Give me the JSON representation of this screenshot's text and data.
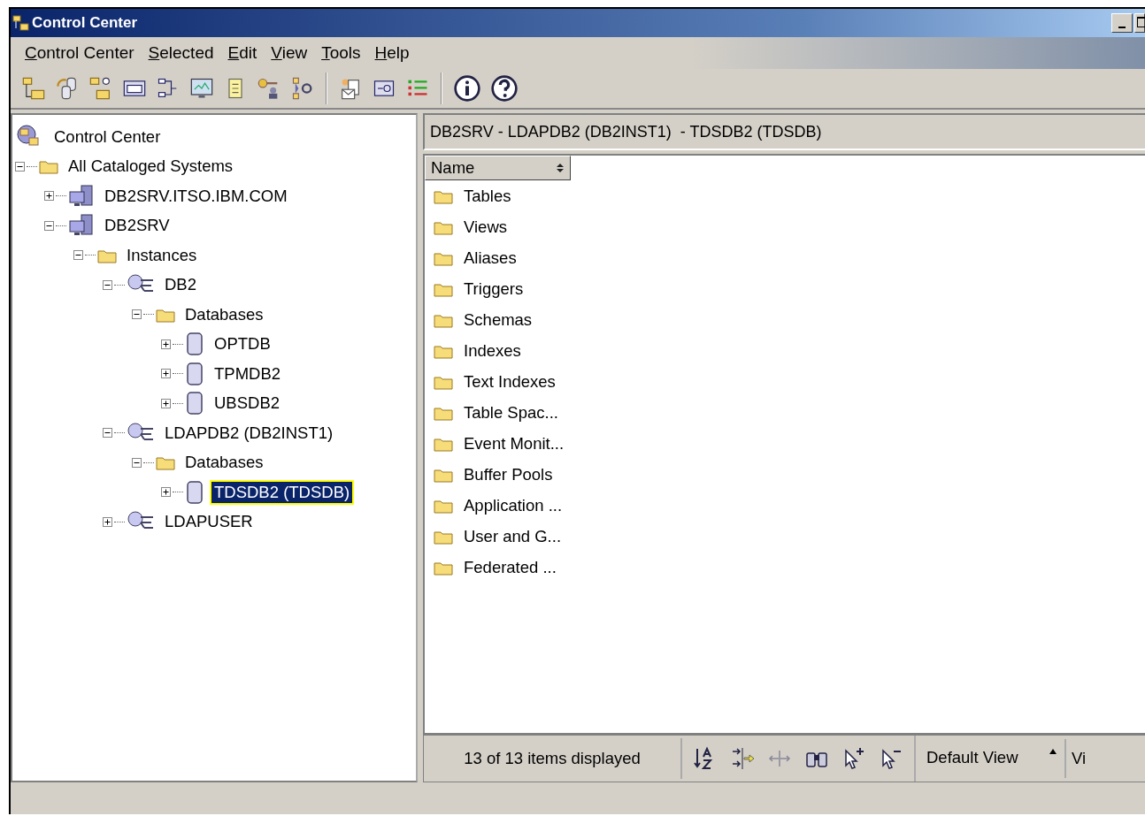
{
  "window": {
    "title": "Control Center"
  },
  "menu": [
    "Control Center",
    "Selected",
    "Edit",
    "View",
    "Tools",
    "Help"
  ],
  "tree": [
    {
      "label": "Control Center",
      "kind": "root",
      "selected": false,
      "children": [
        {
          "label": "All Cataloged Systems",
          "kind": "folder",
          "expanded": true,
          "selected": false,
          "children": [
            {
              "label": "DB2SRV.ITSO.IBM.COM",
              "kind": "system",
              "expanded": false,
              "selected": false
            },
            {
              "label": "DB2SRV",
              "kind": "system",
              "expanded": true,
              "selected": false,
              "children": [
                {
                  "label": "Instances",
                  "kind": "folder",
                  "expanded": true,
                  "selected": false,
                  "children": [
                    {
                      "label": "DB2",
                      "kind": "instance",
                      "expanded": true,
                      "selected": false,
                      "children": [
                        {
                          "label": "Databases",
                          "kind": "folder",
                          "expanded": true,
                          "selected": false,
                          "children": [
                            {
                              "label": "OPTDB",
                              "kind": "database",
                              "expanded": false,
                              "selected": false
                            },
                            {
                              "label": "TPMDB2",
                              "kind": "database",
                              "expanded": false,
                              "selected": false
                            },
                            {
                              "label": "UBSDB2",
                              "kind": "database",
                              "expanded": false,
                              "selected": false
                            }
                          ]
                        }
                      ]
                    },
                    {
                      "label": "LDAPDB2 (DB2INST1)",
                      "kind": "instance",
                      "expanded": true,
                      "selected": false,
                      "children": [
                        {
                          "label": "Databases",
                          "kind": "folder",
                          "expanded": true,
                          "selected": false,
                          "children": [
                            {
                              "label": "TDSDB2 (TDSDB)",
                              "kind": "database",
                              "expanded": false,
                              "selected": true
                            }
                          ]
                        }
                      ]
                    },
                    {
                      "label": "LDAPUSER",
                      "kind": "instance",
                      "expanded": false,
                      "selected": false
                    }
                  ]
                }
              ]
            }
          ]
        }
      ]
    }
  ],
  "content": {
    "path": "DB2SRV - LDAPDB2 (DB2INST1)  - TDSDB2 (TDSDB)",
    "column": "Name",
    "items": [
      "Tables",
      "Views",
      "Aliases",
      "Triggers",
      "Schemas",
      "Indexes",
      "Text Indexes",
      "Table Spac...",
      "Event Monit...",
      "Buffer Pools",
      "Application ...",
      "User and G...",
      "Federated ..."
    ]
  },
  "status": {
    "text": "13 of 13 items displayed",
    "view": "Default View",
    "column_3": "Vi"
  }
}
